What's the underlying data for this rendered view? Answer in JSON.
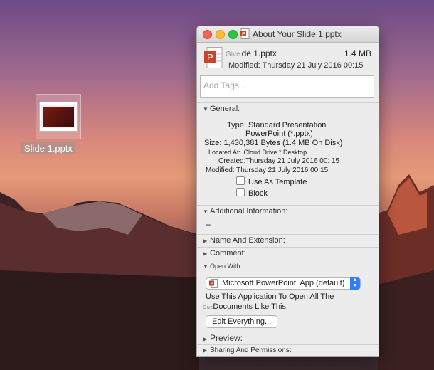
{
  "desktop": {
    "file_label": "Slide 1.pptx",
    "icon": "pptx-thumbnail-icon"
  },
  "window": {
    "title": "About Your Slide 1.pptx",
    "header": {
      "name_prefix": "Give",
      "name": "de 1.pptx",
      "size": "1.4 MB",
      "modified": "Modified: Thursday 21 July 2016 00:15"
    },
    "tags_placeholder": "Add Tags...",
    "general": {
      "heading": "General:",
      "type_line1": "Type: Standard Presentation",
      "type_line2": "PowerPoint (*.pptx)",
      "size": "Size: 1,430,381 Bytes (1.4 MB On Disk)",
      "located": "Located At: iCloud Drive * Desktop",
      "created": "Created:Thursday 21 July 2016 00: 15",
      "modified": "Modified: Thursday 21 July 2016 00:15",
      "use_as_template": "Use As Template",
      "block": "Block"
    },
    "additional": {
      "heading": "Additional Information:",
      "value": "--"
    },
    "name_extension": "Name And Extension:",
    "comment": "Comment:",
    "open_with": {
      "heading": "Open With:",
      "app": "Microsoft PowerPoint. App (default)",
      "desc_line1": "Use This Application To Open All The",
      "desc_prefix": "Give",
      "desc_line2": "Documents Like This.",
      "button": "Edit Everything..."
    },
    "preview": "Preview:",
    "sharing": "Sharing And Permissions:"
  },
  "colors": {
    "accent": "#2f7ef5",
    "powerpoint": "#c8442a"
  }
}
